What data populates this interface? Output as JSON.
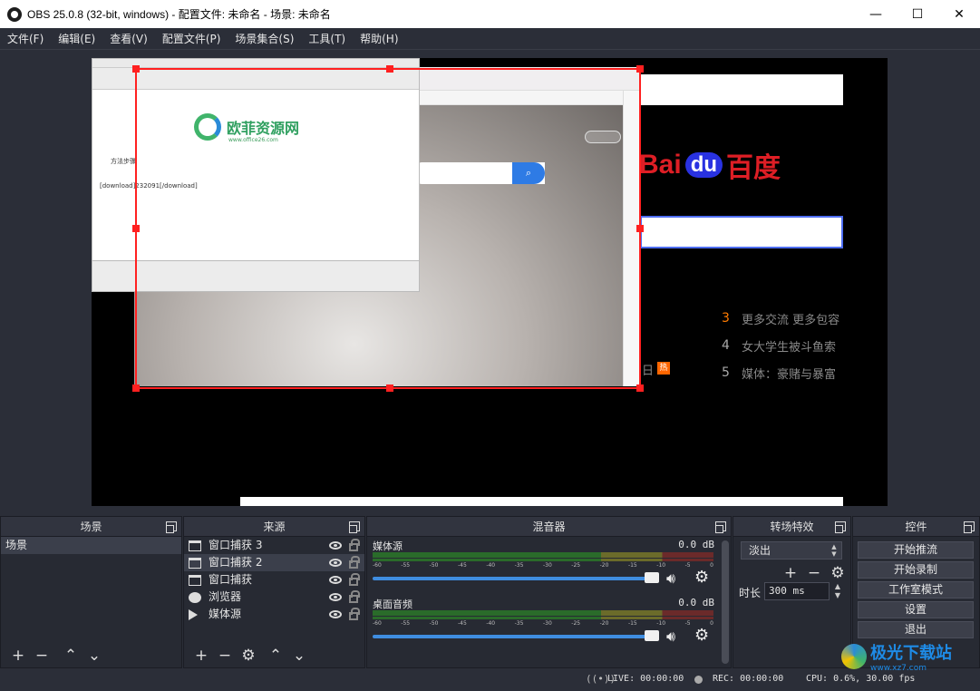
{
  "window": {
    "title": "OBS 25.0.8 (32-bit, windows) - 配置文件: 未命名 - 场景: 未命名",
    "minimize": "—",
    "maximize": "☐",
    "close": "✕"
  },
  "menu": [
    "文件(F)",
    "编辑(E)",
    "查看(V)",
    "配置文件(P)",
    "场景集合(S)",
    "工具(T)",
    "帮助(H)"
  ],
  "preview": {
    "editor": {
      "logo_cn": "欧菲资源网",
      "logo_url": "www.office26.com",
      "line1": "方法步骤",
      "line2": "[download]232091[/download]"
    },
    "browser": {
      "search_button": "⌕"
    },
    "baidu": {
      "logo_left": "Bai",
      "logo_du": "du",
      "logo_cn": "百度",
      "hot_side": "日",
      "hot_badge": "热",
      "hot_items": [
        {
          "num": "3",
          "text": "更多交流 更多包容"
        },
        {
          "num": "4",
          "text": "女大学生被斗鱼索"
        },
        {
          "num": "5",
          "text": "媒体：豪赌与暴富"
        }
      ]
    }
  },
  "docks": {
    "scenes": {
      "title": "场景",
      "items": [
        "场景"
      ]
    },
    "sources": {
      "title": "来源",
      "items": [
        {
          "label": "窗口捕获 3",
          "icon": "window-icon"
        },
        {
          "label": "窗口捕获 2",
          "icon": "window-icon"
        },
        {
          "label": "窗口捕获",
          "icon": "window-icon"
        },
        {
          "label": "浏览器",
          "icon": "globe-icon"
        },
        {
          "label": "媒体源",
          "icon": "play-icon"
        }
      ]
    },
    "mixer": {
      "title": "混音器",
      "ticks": [
        "-60",
        "-55",
        "-50",
        "-45",
        "-40",
        "-35",
        "-30",
        "-25",
        "-20",
        "-15",
        "-10",
        "-5",
        "0"
      ],
      "channels": [
        {
          "name": "媒体源",
          "db": "0.0 dB"
        },
        {
          "name": "桌面音频",
          "db": "0.0 dB"
        }
      ]
    },
    "transitions": {
      "title": "转场特效",
      "selected": "淡出",
      "duration_label": "时长",
      "duration_value": "300 ms"
    },
    "controls": {
      "title": "控件",
      "buttons": [
        "开始推流",
        "开始录制",
        "工作室模式",
        "设置",
        "退出"
      ]
    }
  },
  "status": {
    "live": "LIVE: 00:00:00",
    "rec": "REC: 00:00:00",
    "cpu": "CPU: 0.6%, 30.00 fps"
  },
  "watermark": {
    "cn": "极光下载站",
    "url": "www.xz7.com"
  }
}
